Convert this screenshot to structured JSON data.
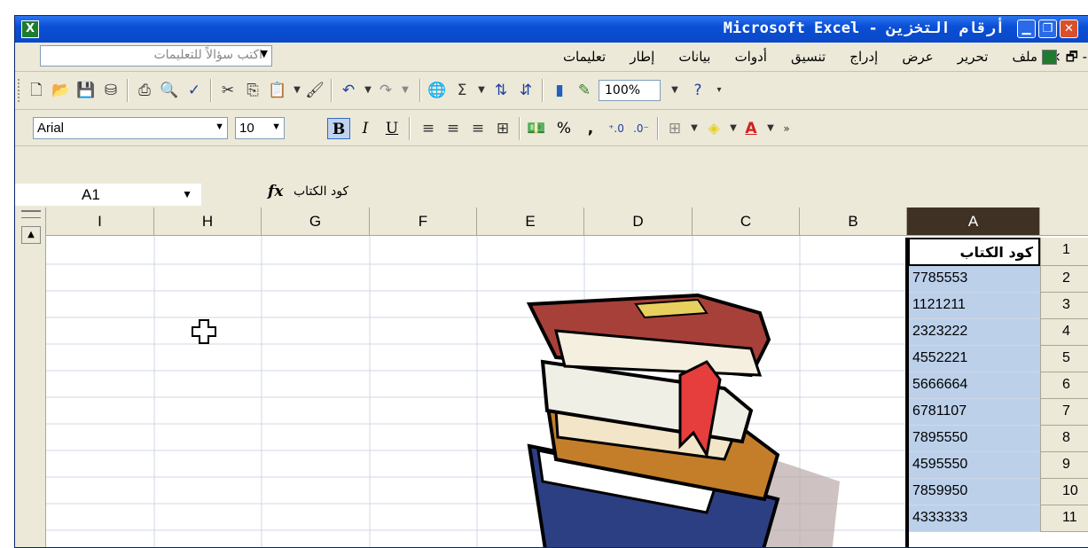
{
  "window": {
    "title": "Microsoft Excel - أرقام التخزين",
    "app_icon_glyph": "X"
  },
  "title_controls": {
    "minimize": "▁",
    "restore": "❐",
    "close": "✕"
  },
  "menu": {
    "items": [
      "ملف",
      "تحرير",
      "عرض",
      "إدراج",
      "تنسيق",
      "أدوات",
      "بيانات",
      "إطار",
      "تعليمات"
    ],
    "doc_controls": "× 🗗 -"
  },
  "ask_box": {
    "placeholder": "اكتب سؤالاً للتعليمات"
  },
  "standard_toolbar": {
    "zoom": "100%",
    "icons": [
      "new-icon",
      "open-icon",
      "save-icon",
      "permission-icon",
      "print-icon",
      "print-preview-icon",
      "spelling-icon",
      "cut-icon",
      "copy-icon",
      "paste-icon",
      "format-painter-icon",
      "undo-icon",
      "redo-icon",
      "hyperlink-icon",
      "autosum-icon",
      "sort-ascending-icon",
      "sort-descending-icon",
      "chart-wizard-icon",
      "drawing-icon",
      "help-icon"
    ]
  },
  "formatting_toolbar": {
    "font": "Arial",
    "size": "10",
    "bold": "B",
    "italic": "I",
    "underline": "U",
    "percent": "%",
    "comma": ","
  },
  "formula_bar": {
    "name_box": "A1",
    "fx": "fx",
    "content": "كود الكتاب"
  },
  "columns": [
    "I",
    "H",
    "G",
    "F",
    "E",
    "D",
    "C",
    "B",
    "A"
  ],
  "selected_column": "A",
  "rows": [
    "1",
    "2",
    "3",
    "4",
    "5",
    "6",
    "7",
    "8",
    "9",
    "10",
    "11"
  ],
  "cells_A": [
    "كود الكتاب",
    "7785553",
    "1121211",
    "2323222",
    "4552221",
    "5666664",
    "6781107",
    "7895550",
    "4595550",
    "7859950",
    "4333333"
  ],
  "colors": {
    "selection_fill": "#bcd0ea",
    "selected_header": "#3f3123",
    "titlebar": "#0a4fd6"
  }
}
